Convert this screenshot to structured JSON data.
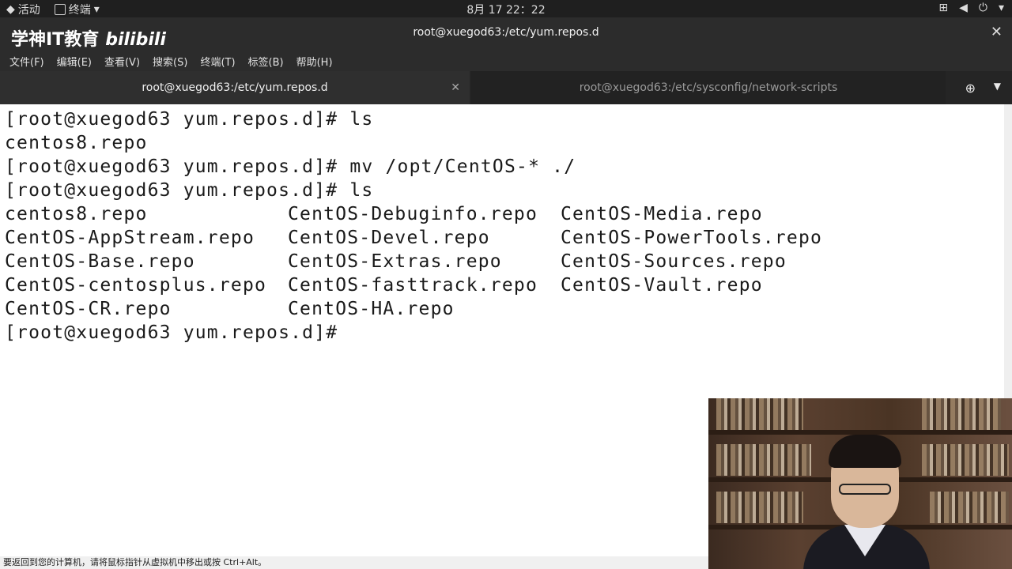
{
  "topbar": {
    "activities": "活动",
    "app_name": "终端",
    "datetime": "8月 17  22：22"
  },
  "window": {
    "logo_text": "学神IT教育",
    "logo_bili": "bilibili",
    "title": "root@xuegod63:/etc/yum.repos.d"
  },
  "menu": {
    "file": "文件(F)",
    "edit": "编辑(E)",
    "view": "查看(V)",
    "search": "搜索(S)",
    "terminal": "终端(T)",
    "tabs": "标签(B)",
    "help": "帮助(H)"
  },
  "tabs": {
    "active": "root@xuegod63:/etc/yum.repos.d",
    "inactive": "root@xuegod63:/etc/sysconfig/network-scripts"
  },
  "terminal": {
    "line1": "[root@xuegod63 yum.repos.d]# ls",
    "line2": "centos8.repo",
    "line3": "[root@xuegod63 yum.repos.d]# mv /opt/CentOS-* ./",
    "line4": "[root@xuegod63 yum.repos.d]# ls",
    "listing": [
      [
        "centos8.repo",
        "CentOS-Debuginfo.repo",
        "CentOS-Media.repo"
      ],
      [
        "CentOS-AppStream.repo",
        "CentOS-Devel.repo",
        "CentOS-PowerTools.repo"
      ],
      [
        "CentOS-Base.repo",
        "CentOS-Extras.repo",
        "CentOS-Sources.repo"
      ],
      [
        "CentOS-centosplus.repo",
        "CentOS-fasttrack.repo",
        "CentOS-Vault.repo"
      ],
      [
        "CentOS-CR.repo",
        "CentOS-HA.repo",
        ""
      ]
    ],
    "prompt": "[root@xuegod63 yum.repos.d]#"
  },
  "status": {
    "message": "要返回到您的计算机，请将鼠标指针从虚拟机中移出或按 Ctrl+Alt。"
  },
  "icons": {
    "activities": "gnome-activities-icon",
    "terminal": "terminal-icon",
    "network": "network-icon",
    "volume": "volume-icon",
    "power": "power-icon"
  }
}
